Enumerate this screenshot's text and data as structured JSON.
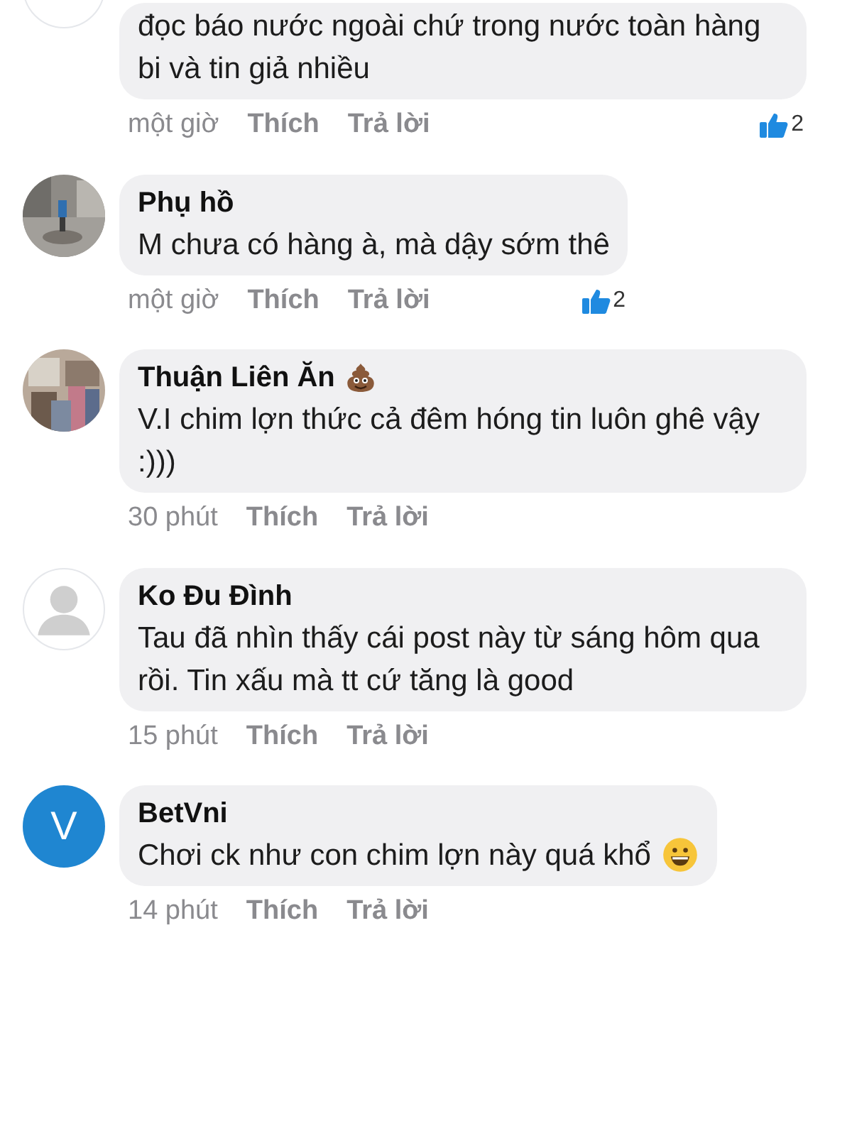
{
  "comments": [
    {
      "kind": "blank",
      "text": "đọc báo nước ngoài chứ trong nước toàn hàng bi và tin giả nhiều",
      "time": "một giờ",
      "like": "Thích",
      "reply": "Trả lời",
      "likes": "2",
      "name_emoji": false,
      "text_emoji": false
    },
    {
      "kind": "picture",
      "name": "Phụ hồ",
      "text": "M chưa có hàng à, mà dậy sớm thê",
      "time": "một giờ",
      "like": "Thích",
      "reply": "Trả lời",
      "likes": "2",
      "name_emoji": false,
      "text_emoji": false
    },
    {
      "kind": "picture",
      "name": "Thuận Liên Ăn",
      "text": "V.I chim lợn thức cả đêm hóng tin luôn ghê vậy :)))",
      "time": "30 phút",
      "like": "Thích",
      "reply": "Trả lời",
      "name_emoji": true,
      "text_emoji": false
    },
    {
      "kind": "silhouette",
      "name": "Ko Đu Đình",
      "text": "Tau đã nhìn thấy cái post này từ sáng hôm qua rồi. Tin xấu mà tt cứ tăng là good",
      "time": "15 phút",
      "like": "Thích",
      "reply": "Trả lời",
      "name_emoji": false,
      "text_emoji": false
    },
    {
      "kind": "letter",
      "initial": "V",
      "name": "BetVni",
      "text": "Chơi ck như con chim lợn này quá khổ",
      "time": "14 phút",
      "like": "Thích",
      "reply": "Trả lời",
      "name_emoji": false,
      "text_emoji": true
    }
  ]
}
